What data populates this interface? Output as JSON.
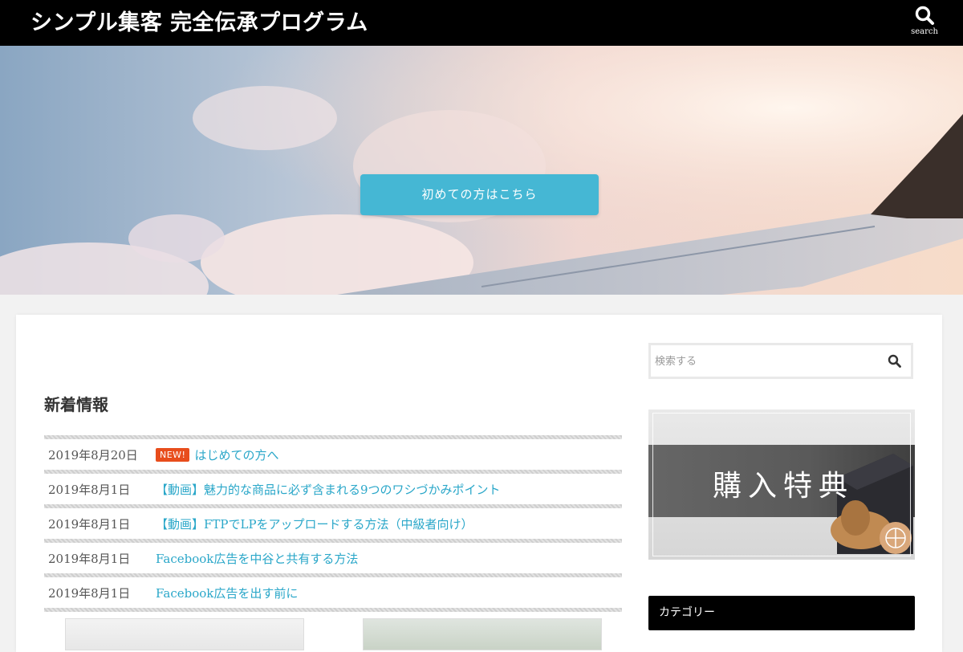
{
  "header": {
    "site_title": "シンプル集客 完全伝承プログラム",
    "search_label": "search"
  },
  "hero": {
    "button_label": "初めての方はこちら"
  },
  "news": {
    "title": "新着情報",
    "items": [
      {
        "date": "2019年8月20日",
        "badge": "NEW!",
        "title": "はじめての方へ"
      },
      {
        "date": "2019年8月1日",
        "title": "【動画】魅力的な商品に必ず含まれる9つのワシづかみポイント"
      },
      {
        "date": "2019年8月1日",
        "title": "【動画】FTPでLPをアップロードする方法（中級者向け）"
      },
      {
        "date": "2019年8月1日",
        "title": "Facebook広告を中谷と共有する方法"
      },
      {
        "date": "2019年8月1日",
        "title": "Facebook広告を出す前に"
      }
    ]
  },
  "sidebar": {
    "search_placeholder": "検索する",
    "bonus_banner_text": "購入特典",
    "category_heading": "カテゴリー"
  },
  "colors": {
    "accent": "#45b7d4",
    "link": "#2aa7c9",
    "new_badge": "#e84d1c",
    "header_bg": "#000000"
  }
}
